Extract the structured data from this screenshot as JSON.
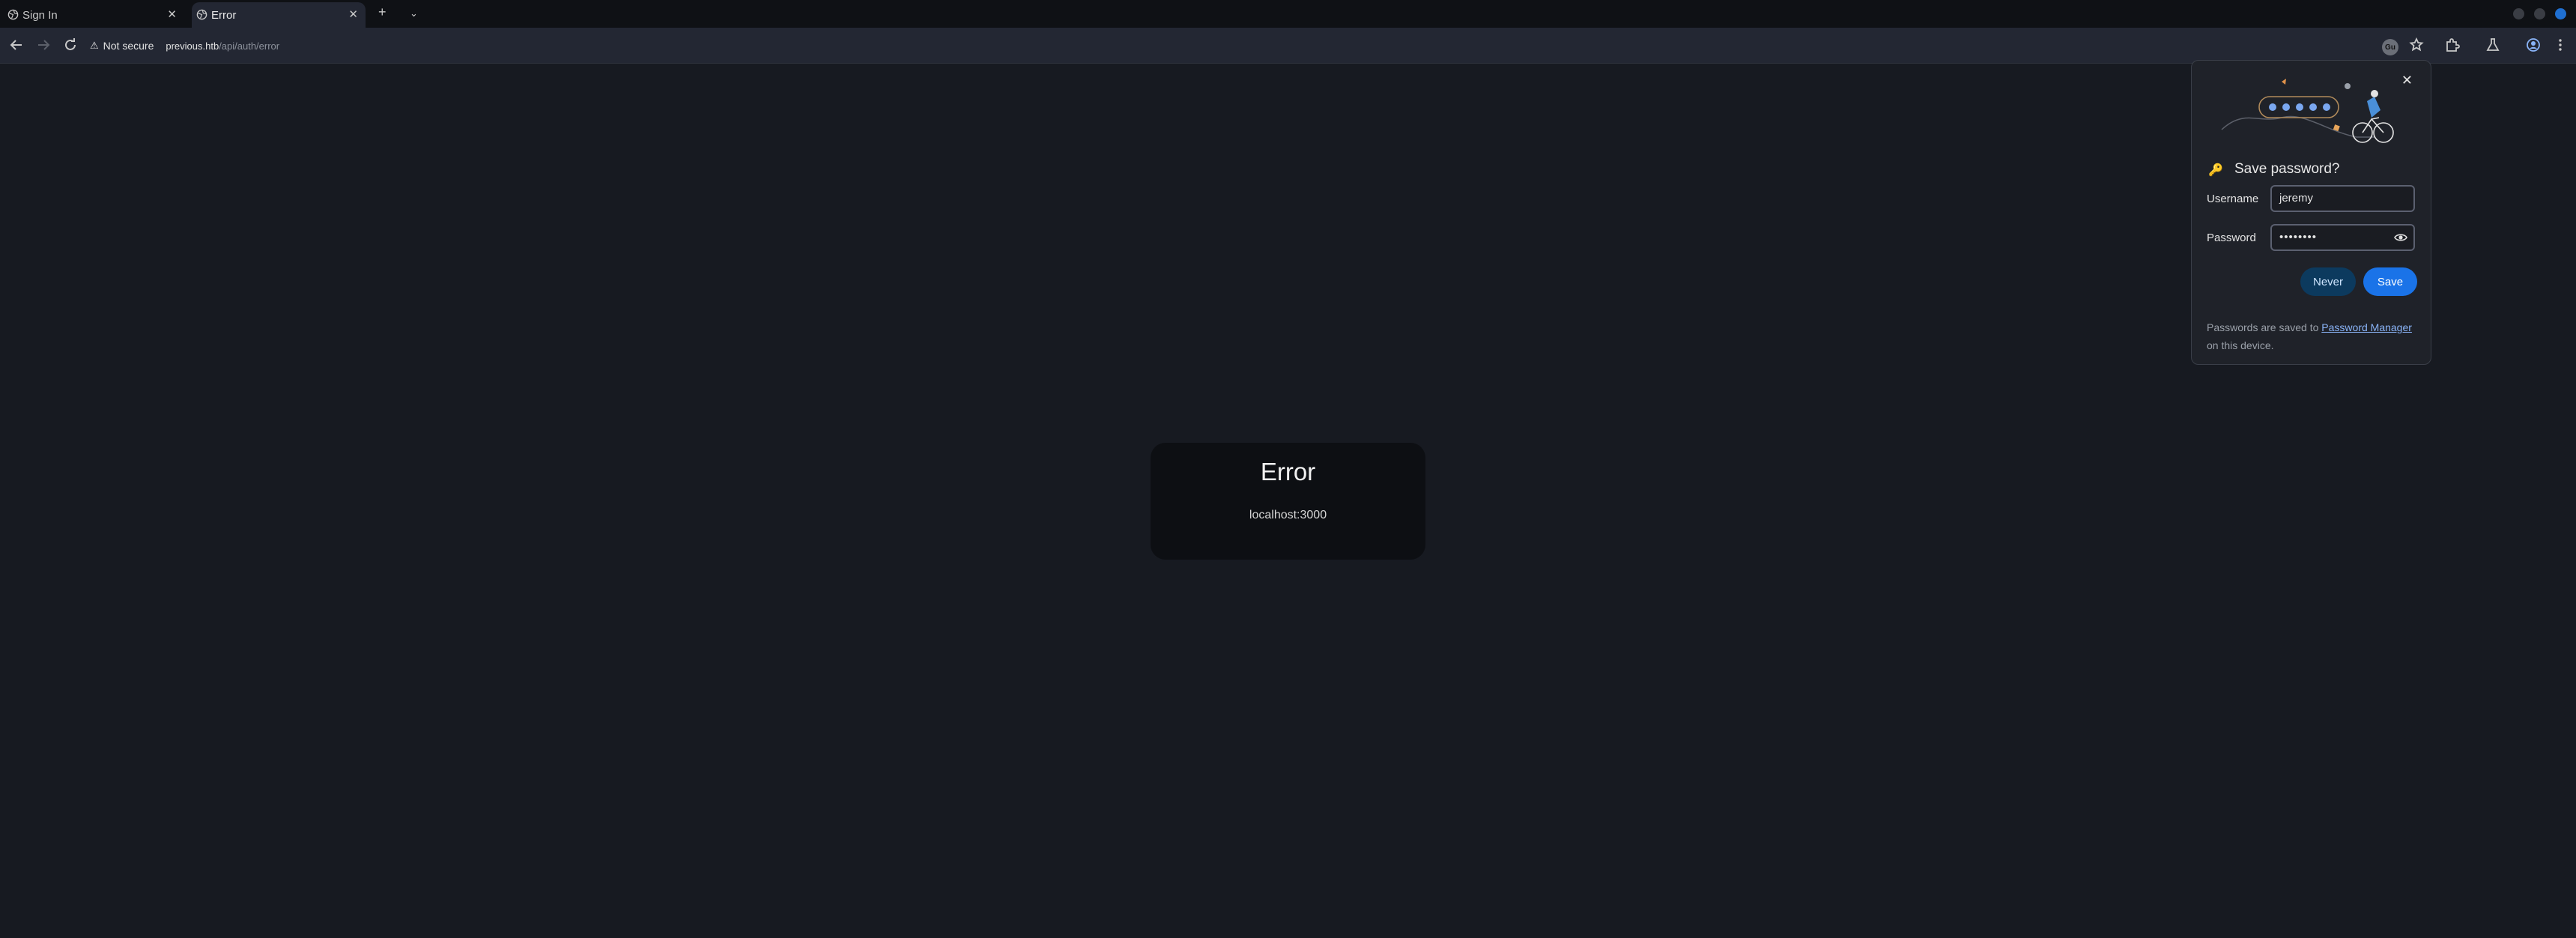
{
  "tabs": [
    {
      "title": "Sign In",
      "active": false
    },
    {
      "title": "Error",
      "active": true
    }
  ],
  "toolbar": {
    "security_label": "Not secure",
    "url_host": "previous.htb",
    "url_path": "/api/auth/error",
    "profile_badge": "Gu"
  },
  "error_page": {
    "title": "Error",
    "message": "localhost:3000"
  },
  "save_password_bubble": {
    "title": "Save password?",
    "username_label": "Username",
    "username_value": "jeremy",
    "password_label": "Password",
    "password_value": "••••••••",
    "never_label": "Never",
    "save_label": "Save",
    "footer_text_before": "Passwords are saved to ",
    "footer_link": "Password Manager",
    "footer_text_after": " on this device."
  },
  "colors": {
    "page_background": "#171a21",
    "accent": "#1a73e8",
    "link": "#8ab4f8"
  }
}
